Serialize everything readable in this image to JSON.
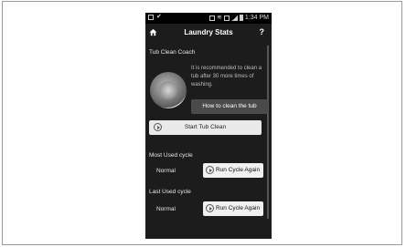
{
  "status_bar": {
    "time": "1:34 PM"
  },
  "header": {
    "title": "Laundry Stats",
    "help_label": "?"
  },
  "tub_clean": {
    "section_title": "Tub Clean Coach",
    "tip_text": "It is recommended to clean a tub after 30 more times of washing.",
    "how_to_label": "How to clean the tub",
    "start_label": "Start Tub Clean"
  },
  "most_used": {
    "section_title": "Most Used cycle",
    "cycle": "Normal",
    "button_label": "Run Cycle Again"
  },
  "last_used": {
    "section_title": "Last Used cycle",
    "cycle": "Normal",
    "button_label": "Run Cycle Again"
  },
  "colors": {
    "background": "#1c1c1c",
    "button_light": "#e9e9e9",
    "button_dark": "#4a4a4a"
  }
}
